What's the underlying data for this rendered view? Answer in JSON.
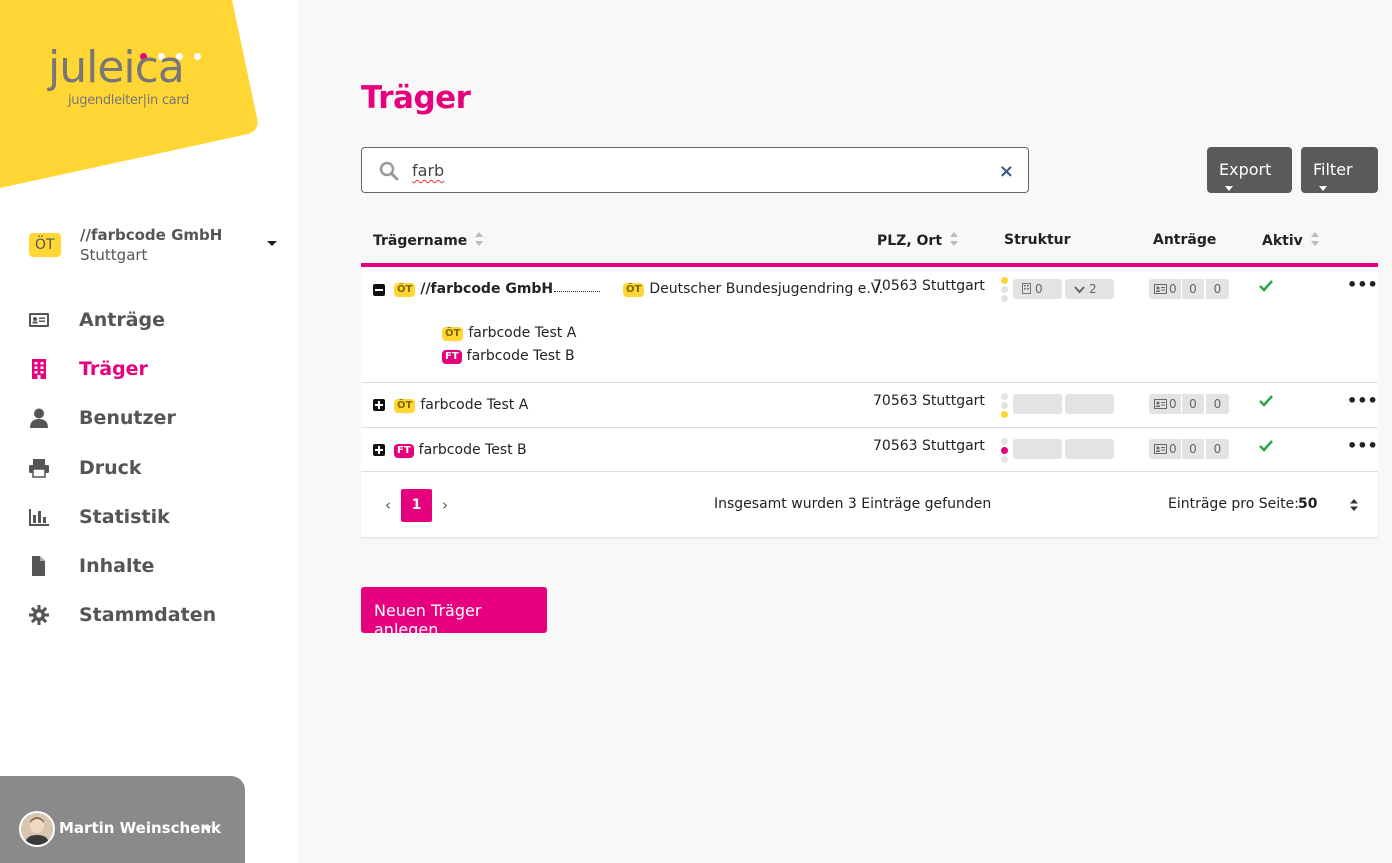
{
  "logo": {
    "word": "juleica",
    "sub": "jugendleiter|in card"
  },
  "org_switch": {
    "badge": "ÖT",
    "name": "//farbcode GmbH",
    "city": "Stuttgart"
  },
  "nav": [
    {
      "label": "Anträge",
      "icon": "id-card-icon",
      "active": false
    },
    {
      "label": "Träger",
      "icon": "building-icon",
      "active": true
    },
    {
      "label": "Benutzer",
      "icon": "user-icon",
      "active": false
    },
    {
      "label": "Druck",
      "icon": "printer-icon",
      "active": false
    },
    {
      "label": "Statistik",
      "icon": "bar-chart-icon",
      "active": false
    },
    {
      "label": "Inhalte",
      "icon": "file-icon",
      "active": false
    },
    {
      "label": "Stammdaten",
      "icon": "gear-icon",
      "active": false
    }
  ],
  "user": {
    "name": "Martin Weinschenk"
  },
  "page_title": "Träger",
  "search": {
    "value": "farb",
    "clear_symbol": "×"
  },
  "buttons": {
    "export": "Export",
    "filter": "Filter",
    "new": "Neuen Träger anlegen"
  },
  "table": {
    "headers": {
      "name": "Trägername",
      "plz": "PLZ, Ort",
      "struktur": "Struktur",
      "antraege": "Anträge",
      "aktiv": "Aktiv"
    },
    "rows": [
      {
        "badge": "ÖT",
        "name": "//farbcode GmbH",
        "parent_badge": "ÖT",
        "parent": "Deutscher Bundesjugendring e.V.",
        "location": "70563 Stuttgart",
        "struct_a": "0",
        "struct_b": "2",
        "antraege": [
          "0",
          "0",
          "0"
        ],
        "active": true,
        "expanded": true,
        "children": [
          {
            "badge": "ÖT",
            "name": "farbcode Test A"
          },
          {
            "badge": "FT",
            "name": "farbcode Test B"
          }
        ]
      },
      {
        "badge": "ÖT",
        "name": "farbcode Test A",
        "location": "70563 Stuttgart",
        "antraege": [
          "0",
          "0",
          "0"
        ],
        "active": true,
        "expanded": false
      },
      {
        "badge": "FT",
        "name": "farbcode Test B",
        "location": "70563 Stuttgart",
        "antraege": [
          "0",
          "0",
          "0"
        ],
        "active": true,
        "expanded": false
      }
    ],
    "more_symbol": "•••"
  },
  "pagination": {
    "prev": "‹",
    "current": "1",
    "next": "›",
    "total_text": "Insgesamt wurden 3 Einträge gefunden",
    "per_page_label": "Einträge pro Seite:",
    "per_page_value": "50"
  },
  "colors": {
    "brand_pink": "#e6007e",
    "brand_yellow": "#ffd633",
    "check_green": "#28a745"
  }
}
